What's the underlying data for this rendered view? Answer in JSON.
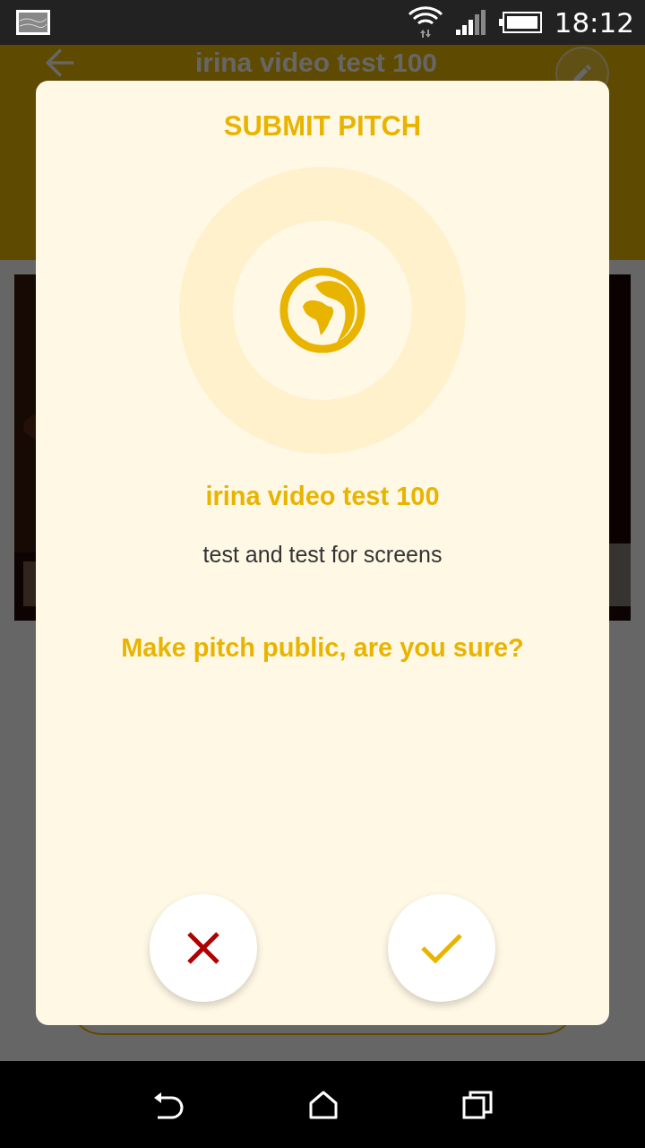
{
  "status_bar": {
    "time": "18:12"
  },
  "header": {
    "title": "irina video test 100"
  },
  "dialog": {
    "title": "SUBMIT PITCH",
    "pitch_name": "irina video test 100",
    "description": "test and test for screens",
    "question": "Make pitch public, are you sure?",
    "buttons": [
      {
        "kind": "cancel"
      },
      {
        "kind": "confirm"
      }
    ]
  }
}
